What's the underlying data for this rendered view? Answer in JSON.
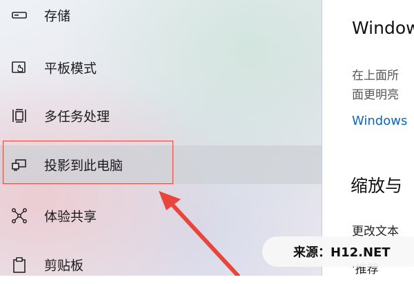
{
  "sidebar": {
    "items": [
      {
        "label": "存储",
        "icon": "storage-icon"
      },
      {
        "label": "平板模式",
        "icon": "tablet-mode-icon"
      },
      {
        "label": "多任务处理",
        "icon": "multitasking-icon"
      },
      {
        "label": "投影到此电脑",
        "icon": "project-to-pc-icon"
      },
      {
        "label": "体验共享",
        "icon": "shared-experiences-icon"
      },
      {
        "label": "剪贴板",
        "icon": "clipboard-icon"
      }
    ],
    "selected_index": 3
  },
  "content": {
    "heading": "Window",
    "desc_line1": "在上面所",
    "desc_line2": "面更明亮",
    "link": "Windows",
    "section_heading": "缩放与",
    "subtext": "更改文本",
    "cut_text": "'推荐"
  },
  "watermark": {
    "text": "来源：H12.NET"
  },
  "colors": {
    "highlight": "#e8453c",
    "link": "#0b66c2",
    "arrow": "#e8453c"
  }
}
